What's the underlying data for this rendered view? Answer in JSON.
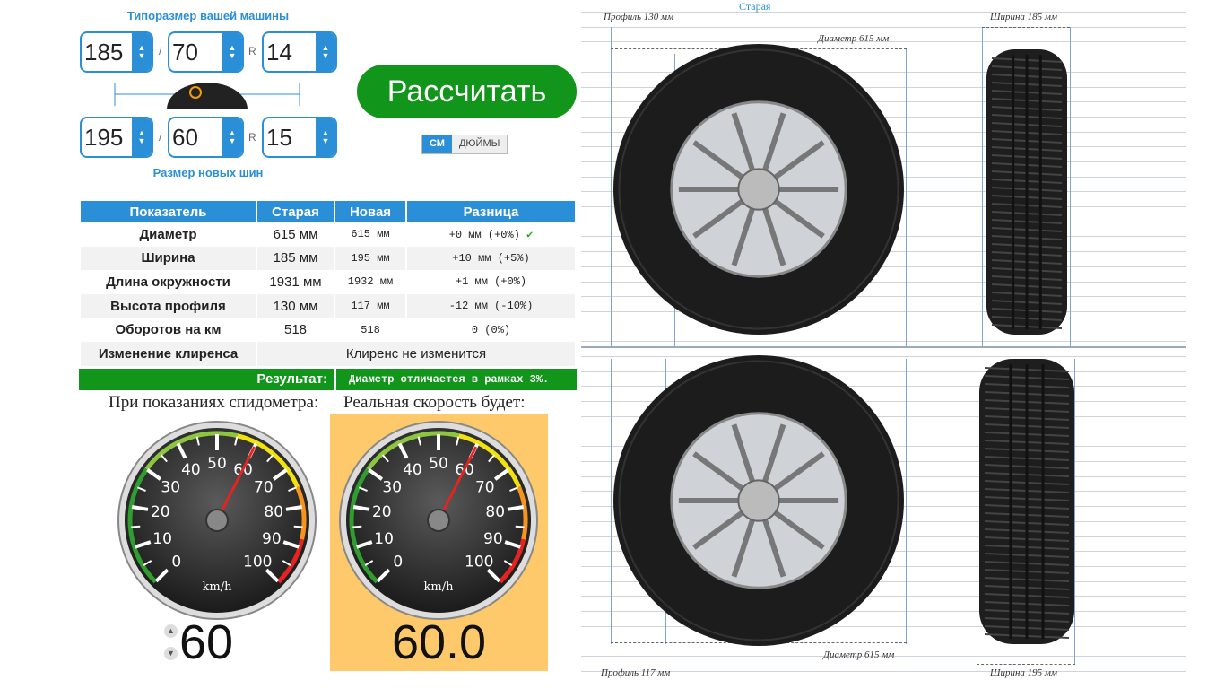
{
  "form": {
    "old_label": "Типоразмер вашей машины",
    "new_label": "Размер новых шин",
    "old": {
      "width": "185",
      "profile": "70",
      "sep_slash": "/",
      "sep_r": "R",
      "rim": "14"
    },
    "new": {
      "width": "195",
      "profile": "60",
      "sep_slash": "/",
      "sep_r": "R",
      "rim": "15"
    },
    "calc_button": "Рассчитать",
    "units": {
      "cm": "СМ",
      "in": "ДЮЙМЫ"
    }
  },
  "table": {
    "headers": [
      "Показатель",
      "Старая",
      "Новая",
      "Разница"
    ],
    "rows": [
      {
        "name": "Диаметр",
        "old": "615 мм",
        "new": "615 мм",
        "diff": "+0 мм (+0%)"
      },
      {
        "name": "Ширина",
        "old": "185 мм",
        "new": "195 мм",
        "diff": "+10 мм (+5%)"
      },
      {
        "name": "Длина окружности",
        "old": "1931 мм",
        "new": "1932 мм",
        "diff": "+1 мм (+0%)"
      },
      {
        "name": "Высота профиля",
        "old": "130 мм",
        "new": "117 мм",
        "diff": "-12 мм (-10%)"
      },
      {
        "name": "Оборотов на км",
        "old": "518",
        "new": "518",
        "diff": "0 (0%)"
      }
    ],
    "clearance_label": "Изменение клиренса",
    "clearance_value": "Клиренс не изменится",
    "result_label": "Результат:",
    "result_value": "Диаметр отличается в рамках 3%."
  },
  "speed": {
    "speedo_caption": "При показаниях спидометра:",
    "real_caption": "Реальная скорость будет:",
    "speedo_value": "60",
    "real_value": "60.0",
    "unit": "km/h",
    "ticks": [
      "0",
      "10",
      "20",
      "30",
      "40",
      "50",
      "60",
      "70",
      "80",
      "90",
      "100"
    ],
    "needle_speed": 60
  },
  "diagram": {
    "old_title": "Старая",
    "old_profile": "Профиль 130 мм",
    "old_diameter": "Диаметр 615 мм",
    "old_width": "Ширина 185 мм",
    "new_profile": "Профиль 117 мм",
    "new_diameter": "Диаметр 615 мм",
    "new_width": "Ширина 195 мм"
  }
}
